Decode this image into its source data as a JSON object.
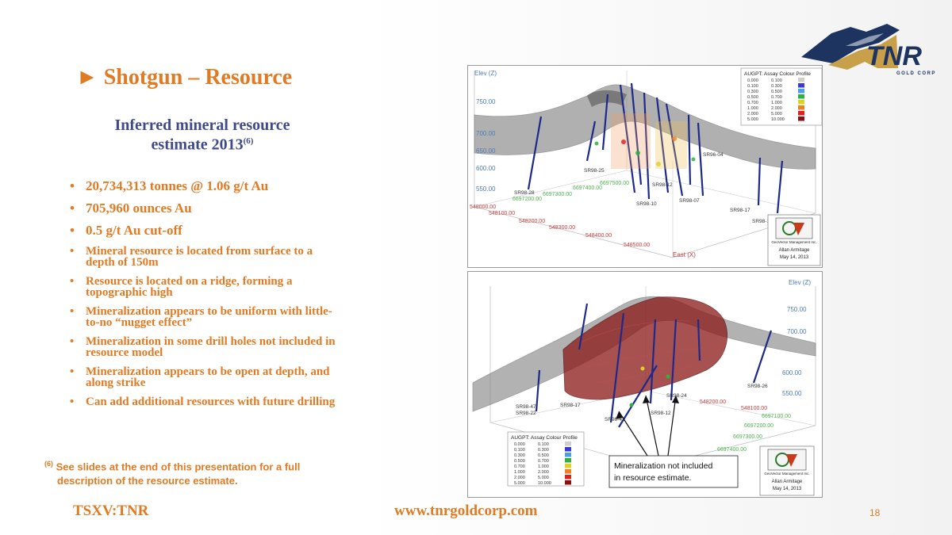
{
  "slide": {
    "title": "► Shotgun – Resource",
    "subtitle": {
      "line1": "Inferred mineral resource",
      "line2": "estimate 2013",
      "sup": "(6)"
    },
    "bullets": [
      {
        "text": "20,734,313 tonnes @ 1.06 g/t Au",
        "size": "big"
      },
      {
        "text": "705,960 ounces Au",
        "size": "big"
      },
      {
        "text": "0.5 g/t Au cut-off",
        "size": "big"
      },
      {
        "text": "Mineral resource is located from surface to a depth of 150m",
        "size": "small"
      },
      {
        "text": "Resource is located on a ridge, forming a topographic high",
        "size": "small"
      },
      {
        "text": "Mineralization appears to be uniform with little-to-no “nugget effect”",
        "size": "small"
      },
      {
        "text": "Mineralization in some drill holes not included in resource model",
        "size": "small"
      },
      {
        "text": "Mineralization appears to be open at depth, and along strike",
        "size": "small"
      },
      {
        "text": "Can add additional resources with future drilling",
        "size": "small"
      }
    ],
    "footnote": {
      "marker": "(6)",
      "line1": "See slides at the end of this presentation for a full",
      "line2": "description of the resource estimate."
    },
    "ticker": "TSXV:TNR",
    "website": "www.tnrgoldcorp.com",
    "page_number": "18"
  },
  "logo": {
    "name": "TNR",
    "tagline": "GOLD CORP"
  },
  "colors": {
    "accent": "#e07b24",
    "subtitle": "#3f4a8a",
    "logo_blue": "#1d3461",
    "logo_gold": "#c9a04a"
  },
  "figure1": {
    "elev_label": "Elev (Z)",
    "east_label": "East (X)",
    "elev_ticks": [
      "750.00",
      "700.00",
      "650.00",
      "600.00",
      "550.00"
    ],
    "north_ticks": [
      "6697200.00",
      "6697300.00",
      "6697400.00",
      "6697500.00"
    ],
    "east_ticks": [
      "548000.00",
      "548100.00",
      "548200.00",
      "548300.00",
      "548400.00",
      "548500.00"
    ],
    "hole_labels": [
      "SR98-28",
      "SR98-25",
      "SR98-12",
      "SR98-10",
      "SR98-07",
      "SR96-04",
      "SR98-17",
      "SR98-1"
    ],
    "legend": {
      "title": "AUGPT: Assay Colour Profile",
      "rows": [
        {
          "from": "0.000",
          "to": "0.100",
          "color": "#cfcfcf"
        },
        {
          "from": "0.100",
          "to": "0.300",
          "color": "#3a3ad0"
        },
        {
          "from": "0.300",
          "to": "0.500",
          "color": "#4aa0e0"
        },
        {
          "from": "0.500",
          "to": "0.700",
          "color": "#30b040"
        },
        {
          "from": "0.700",
          "to": "1.000",
          "color": "#e0d020"
        },
        {
          "from": "1.000",
          "to": "2.000",
          "color": "#f08020"
        },
        {
          "from": "2.000",
          "to": "5.000",
          "color": "#e02020"
        },
        {
          "from": "5.000",
          "to": "10.000",
          "color": "#8a1010"
        }
      ]
    },
    "credit": {
      "company": "GeoVector Management Inc.",
      "author": "Allan Armitage",
      "date": "May 14, 2013"
    }
  },
  "figure2": {
    "elev_label": "Elev (Z)",
    "elev_ticks": [
      "750.00",
      "700.00",
      "600.00",
      "550.00"
    ],
    "north_ticks": [
      "6697100.00",
      "6697200.00",
      "6697300.00",
      "6697400.00"
    ],
    "east_ticks": [
      "548200.00",
      "548100.00"
    ],
    "hole_labels": [
      "SR98-47",
      "SR98-22",
      "SR98-17",
      "SR98-12",
      "SR98-24",
      "SR98-26",
      "SR98-41"
    ],
    "callout": {
      "line1": "Mineralization not included",
      "line2": "in resource estimate."
    },
    "credit": {
      "company": "GeoVector Management Inc.",
      "author": "Allan Armitage",
      "date": "May 14, 2013"
    }
  }
}
